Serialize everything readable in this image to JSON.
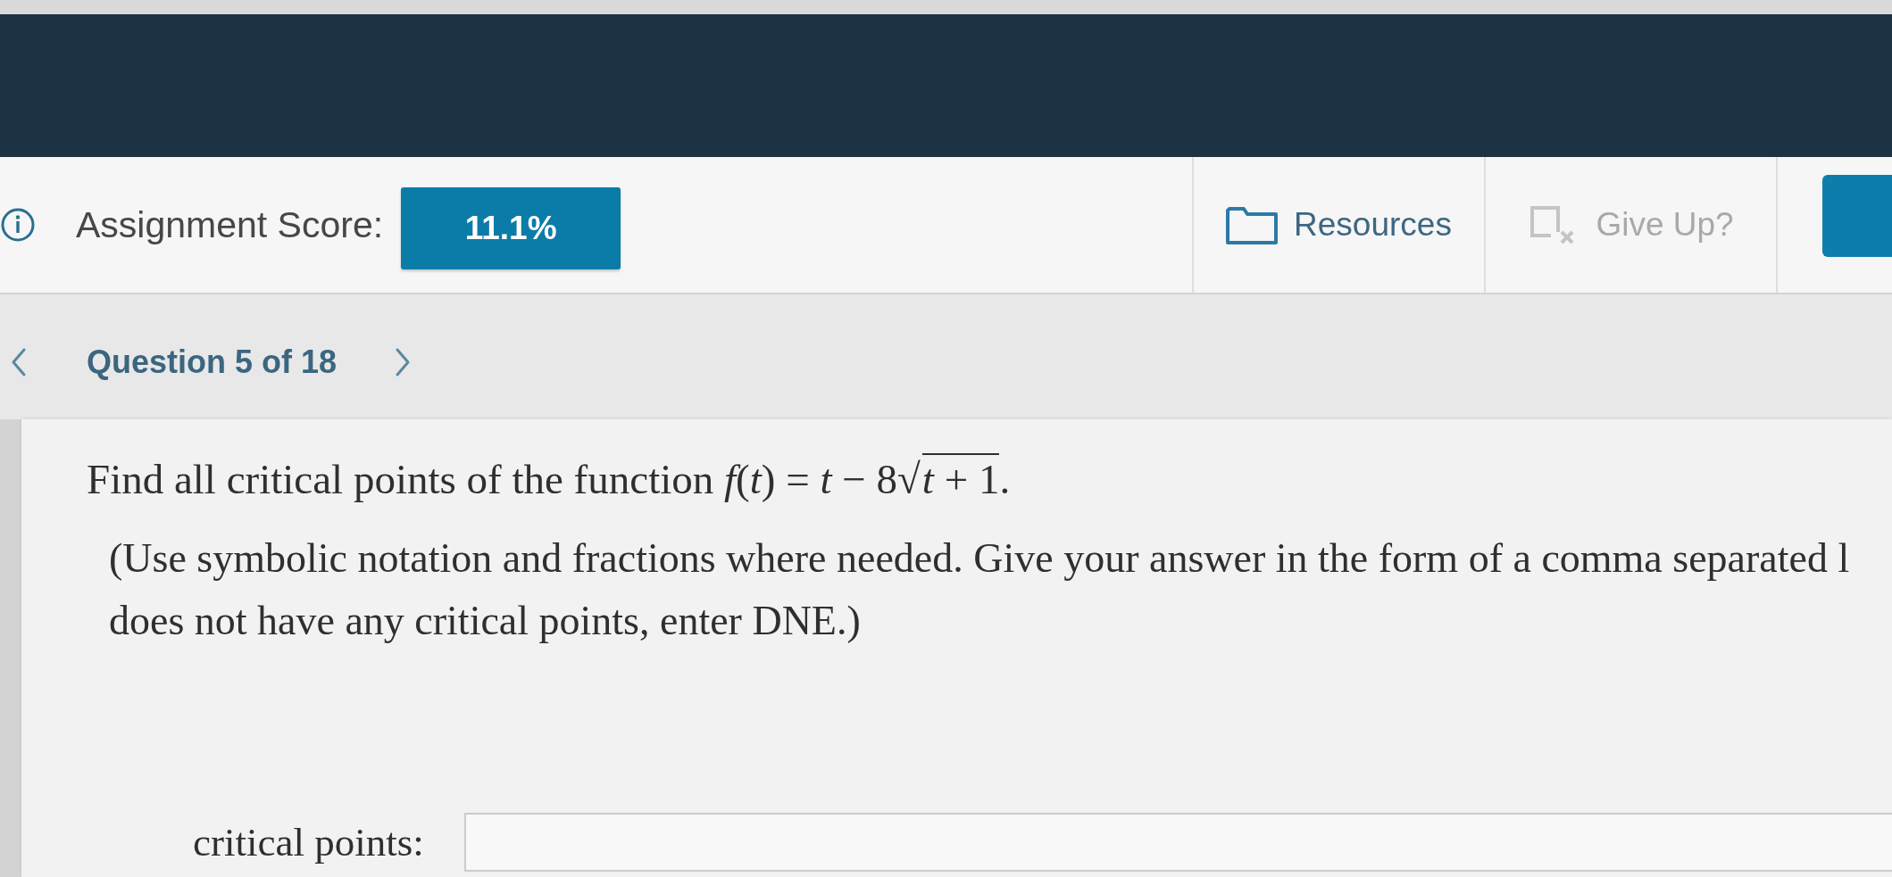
{
  "header": {
    "score_label": "Assignment Score:",
    "score": "11.1%"
  },
  "tools": [
    {
      "kind": "folder",
      "label": "Resources",
      "disabled": false
    },
    {
      "kind": "give-up",
      "label": "Give Up?",
      "disabled": true
    }
  ],
  "navigation": {
    "label": "Question 5 of 18"
  },
  "question": {
    "prefix": "Find all critical points of the function *f*(*t*) = *t* − 8",
    "radical": "√",
    "radicand": "*t* + 1",
    "suffix": "."
  },
  "instructions": [
    "(Use symbolic notation and fractions where needed. Give your answer in the form of a comma separated l",
    "does not have any critical points, enter DNE.)"
  ],
  "answer": {
    "label": "critical points:"
  }
}
